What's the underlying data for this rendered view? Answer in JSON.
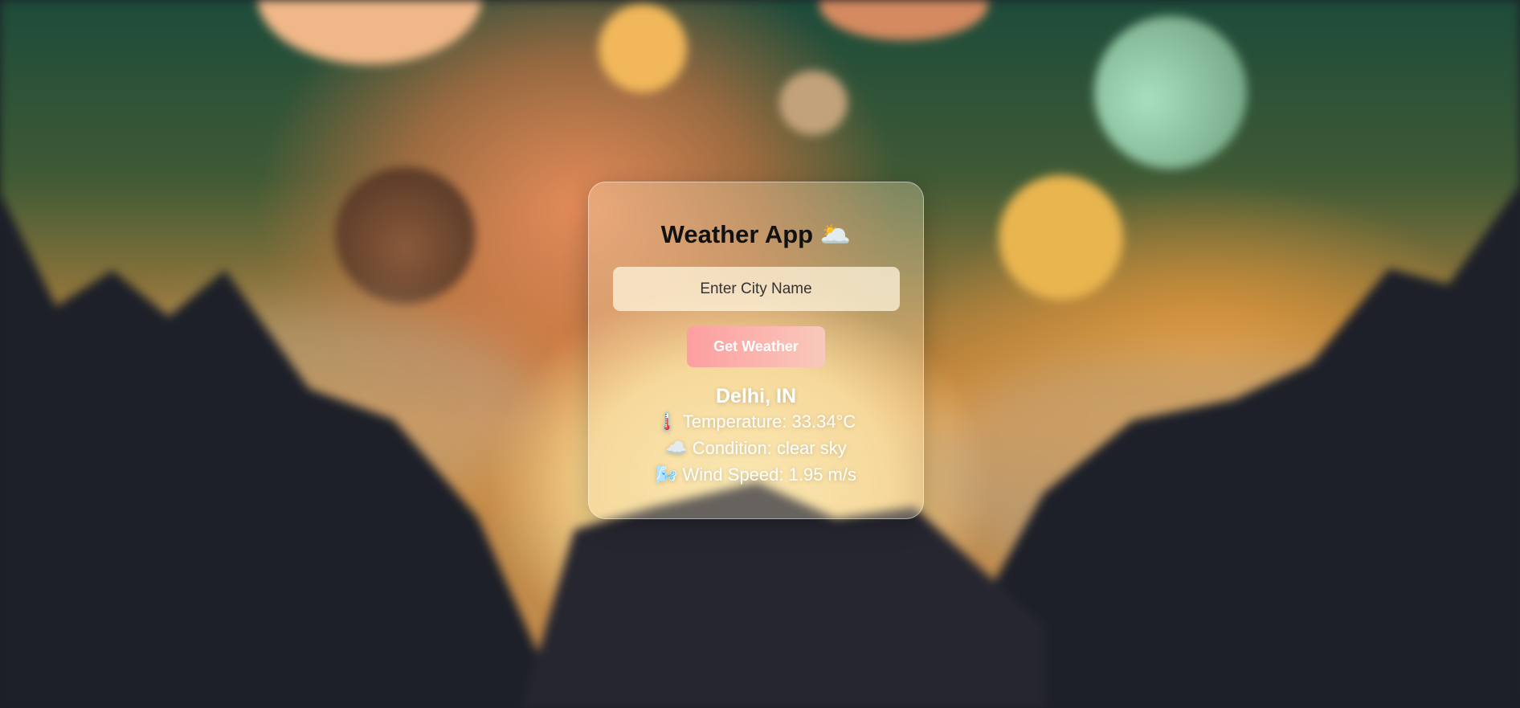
{
  "app": {
    "title": "Weather App",
    "title_icon": "🌥️"
  },
  "search": {
    "placeholder": "Enter City Name",
    "value": ""
  },
  "button": {
    "label": "Get Weather"
  },
  "result": {
    "city": "Delhi, IN",
    "temperature": {
      "icon": "🌡️",
      "text": "Temperature: 33.34°C"
    },
    "condition": {
      "icon": "☁️",
      "text": "Condition: clear sky"
    },
    "wind": {
      "icon": "🌬️",
      "text": "Wind Speed: 1.95 m/s"
    }
  },
  "colors": {
    "button_start": "#fd9ea0",
    "button_end": "#f9c9bc"
  }
}
